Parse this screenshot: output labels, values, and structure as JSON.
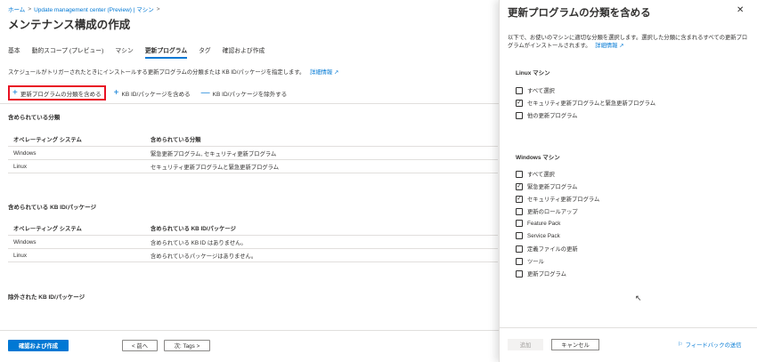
{
  "breadcrumb": {
    "home": "ホーム",
    "sep": ">",
    "item1": "Update management center (Preview) | マシン",
    "sep2": ">"
  },
  "page": {
    "title": "メンテナンス構成の作成",
    "more": "···"
  },
  "tabs": [
    {
      "label": "基本"
    },
    {
      "label": "動的スコープ (プレビュー)"
    },
    {
      "label": "マシン"
    },
    {
      "label": "更新プログラム"
    },
    {
      "label": "タグ"
    },
    {
      "label": "確認および作成"
    }
  ],
  "description": {
    "text": "スケジュールがトリガーされたときにインストールする更新プログラムの分類または KB ID/パッケージを指定します。",
    "link": "詳細情報"
  },
  "toolbar": {
    "include_classification": "更新プログラムの分類を含める",
    "include_kb": "KB ID/パッケージを含める",
    "exclude_kb": "KB ID/パッケージを除外する"
  },
  "included_classifications": {
    "title": "含められている分類",
    "headers": [
      "オペレーティング システム",
      "含められている分類"
    ],
    "rows": [
      [
        "Windows",
        "緊急更新プログラム, セキュリティ更新プログラム"
      ],
      [
        "Linux",
        "セキュリティ更新プログラムと緊急更新プログラム"
      ]
    ]
  },
  "included_kb": {
    "title": "含められている KB ID/パッケージ",
    "headers": [
      "オペレーティング システム",
      "含められている KB ID/パッケージ"
    ],
    "rows": [
      [
        "Windows",
        "含められている KB ID はありません。"
      ],
      [
        "Linux",
        "含められているパッケージはありません。"
      ]
    ]
  },
  "excluded_kb": {
    "title": "除外された KB ID/パッケージ"
  },
  "footer": {
    "review_create": "確認および作成",
    "prev": "< 前へ",
    "next": "次: Tags >"
  },
  "panel": {
    "title": "更新プログラムの分類を含める",
    "description": "以下で、お使いのマシンに適切な分類を選択します。選択した分類に含まれるすべての更新プログラムがインストールされます。",
    "link": "詳細情報",
    "linux": {
      "title": "Linux マシン",
      "options": [
        {
          "label": "すべて選択",
          "checked": false
        },
        {
          "label": "セキュリティ更新プログラムと緊急更新プログラム",
          "checked": true
        },
        {
          "label": "他の更新プログラム",
          "checked": false
        }
      ]
    },
    "windows": {
      "title": "Windows マシン",
      "options": [
        {
          "label": "すべて選択",
          "checked": false
        },
        {
          "label": "緊急更新プログラム",
          "checked": true
        },
        {
          "label": "セキュリティ更新プログラム",
          "checked": true
        },
        {
          "label": "更新のロールアップ",
          "checked": false
        },
        {
          "label": "Feature Pack",
          "checked": false
        },
        {
          "label": "Service Pack",
          "checked": false
        },
        {
          "label": "定義ファイルの更新",
          "checked": false
        },
        {
          "label": "ツール",
          "checked": false
        },
        {
          "label": "更新プログラム",
          "checked": false
        }
      ]
    },
    "add": "追加",
    "cancel": "キャンセル",
    "feedback": "フィードバックの送信"
  },
  "colors": {
    "accent": "#0078d4",
    "highlight": "#e81123"
  }
}
